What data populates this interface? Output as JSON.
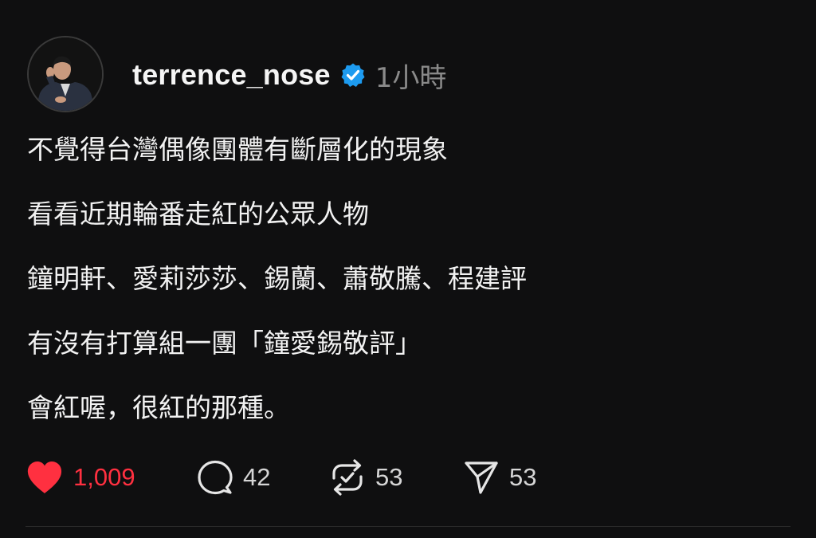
{
  "post": {
    "author": {
      "username": "terrence_nose",
      "verified": true,
      "avatar_icon": "profile-photo"
    },
    "time": "1小時",
    "lines": [
      "不覺得台灣偶像團體有斷層化的現象",
      "看看近期輪番走紅的公眾人物",
      "鐘明軒、愛莉莎莎、錫蘭、蕭敬騰、程建評",
      "有沒有打算組一團「鐘愛錫敬評」",
      "會紅喔，很紅的那種。"
    ],
    "actions": {
      "likes": "1,009",
      "comments": "42",
      "reposts": "53",
      "shares": "53"
    }
  },
  "colors": {
    "background": "#0f0f10",
    "like_red": "#ff3040",
    "verified_blue": "#1d9bf0",
    "muted": "#8a8a8a"
  }
}
